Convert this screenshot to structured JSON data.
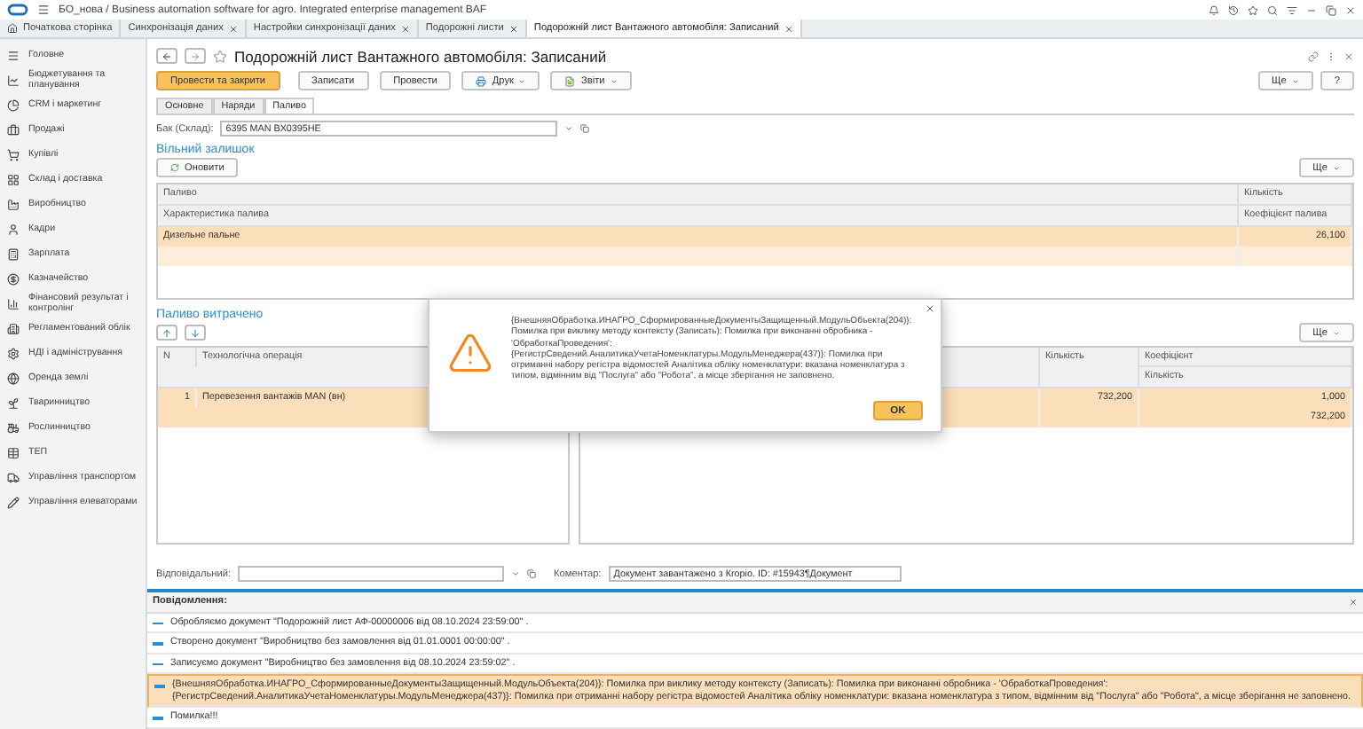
{
  "app": {
    "title": "БО_нова / Business automation software for agro. Integrated enterprise management BAF"
  },
  "tabs": [
    {
      "label": "Початкова сторінка",
      "kind": "home",
      "selected": false
    },
    {
      "label": "Синхронізація даних",
      "kind": "doc",
      "selected": false
    },
    {
      "label": "Настройки синхронізації даних",
      "kind": "doc",
      "selected": false
    },
    {
      "label": "Подорожні листи",
      "kind": "doc",
      "selected": false
    },
    {
      "label": "Подорожній лист Вантажного автомобіля: Записаний",
      "kind": "doc",
      "selected": true
    }
  ],
  "sidebar": {
    "items": [
      {
        "label": "Головне"
      },
      {
        "label": "Бюджетування та планування"
      },
      {
        "label": "CRM і маркетинг"
      },
      {
        "label": "Продажі"
      },
      {
        "label": "Купівлі"
      },
      {
        "label": "Склад і доставка"
      },
      {
        "label": "Виробництво"
      },
      {
        "label": "Кадри"
      },
      {
        "label": "Зарплата"
      },
      {
        "label": "Казначейство"
      },
      {
        "label": "Фінансовий результат і контролінг"
      },
      {
        "label": "Регламентований облік"
      },
      {
        "label": "НДІ і адміністрування"
      },
      {
        "label": "Оренда землі"
      },
      {
        "label": "Тваринництво"
      },
      {
        "label": "Рослинництво"
      },
      {
        "label": "ТЕП"
      },
      {
        "label": "Управління транспортом"
      },
      {
        "label": "Управління елеваторами"
      }
    ]
  },
  "document": {
    "title": "Подорожній лист Вантажного автомобіля: Записаний",
    "buttons": [
      {
        "label": "Провести та закрити",
        "kind": "primary"
      },
      {
        "label": "Записати",
        "kind": "plain"
      },
      {
        "label": "Провести",
        "kind": "plain"
      },
      {
        "label": "Друк",
        "kind": "print"
      },
      {
        "label": "Звіти",
        "kind": "reports"
      }
    ],
    "more": "Ще",
    "help": "?",
    "form_tabs": [
      {
        "label": "Основне",
        "selected": false
      },
      {
        "label": "Наряди",
        "selected": false
      },
      {
        "label": "Паливо",
        "selected": true
      }
    ],
    "tank": {
      "label": "Бак (Склад):",
      "value": "6395  MAN BX0395HE"
    },
    "free_stock": {
      "title": "Вільний залишок",
      "refresh": "Оновити",
      "more": "Ще",
      "header_top": [
        "Паливо",
        "Кількість"
      ],
      "header_bottom": [
        "Характеристика палива",
        "Коефіцієнт палива"
      ],
      "rows": [
        {
          "fuel": "Дизельне пальне",
          "quantity": "26,100",
          "selected": true
        }
      ]
    },
    "fuel_used": {
      "title": "Паливо витрачено",
      "more": "Ще",
      "left": {
        "columns": [
          "N",
          "Технологічна операція"
        ],
        "rows": [
          {
            "n": "1",
            "operation": "Перевезення вантажів MAN (вн)",
            "selected": true
          }
        ]
      },
      "right": {
        "header_top": [
          "Кількість",
          "Коефіцієнт"
        ],
        "header_bottom": [
          "Кількість"
        ],
        "rows": [
          {
            "quantity": "732,200",
            "coefficient": "1,000",
            "total": "732,200",
            "selected": true
          }
        ]
      }
    },
    "responsible": {
      "label": "Відповідальний:"
    },
    "comment": {
      "label": "Коментар:",
      "value": "Документ завантажено з Кropio. ID: #15943¶Документ"
    }
  },
  "messages": {
    "title": "Повідомлення:",
    "items": [
      {
        "text": "Обробляємо документ \"Подорожній лист АФ-00000006 від 08.10.2024 23:59:00\" .",
        "selected": false
      },
      {
        "text": "Створено документ \"Виробництво без замовлення  від 01.01.0001 00:00:00\" .",
        "selected": false
      },
      {
        "text": "Записуємо документ \"Виробництво без замовлення  від 08.10.2024 23:59:02\" .",
        "selected": false
      },
      {
        "text": "{ВнешняяОбработка.ИНАГРО_СформированныеДокументыЗащищенный.МодульОбъекта(204)}: Помилка при виклику методу контексту (Записать): Помилка при виконанні обробника - 'ОбработкаПроведения': {РегистрСведений.АналитикаУчетаНоменклатуры.МодульМенеджера(437)}: Помилка при отриманні набору регістра відомостей Аналітика обліку номенклатури: вказана номенклатура з типом, відмінним від \"Послуга\" або \"Робота\", а місце зберігання не заповнено.",
        "selected": true
      },
      {
        "text": "Помилка!!!",
        "selected": false
      }
    ]
  },
  "dialog": {
    "text": "{ВнешняяОбработка.ИНАГРО_СформированныеДокументыЗащищенный.МодульОбъекта(204)}: Помилка при виклику методу контексту (Записать): Помилка при виконанні обробника - 'ОбработкаПроведения': {РегистрСведений.АналитикаУчетаНоменклатуры.МодульМенеджера(437)}: Помилка при отриманні набору регістра відомостей Аналітика обліку номенклатури: вказана номенклатура з типом, відмінним від \"Послуга\" або \"Робота\", а місце зберігання не заповнено.",
    "ok": "OK"
  }
}
